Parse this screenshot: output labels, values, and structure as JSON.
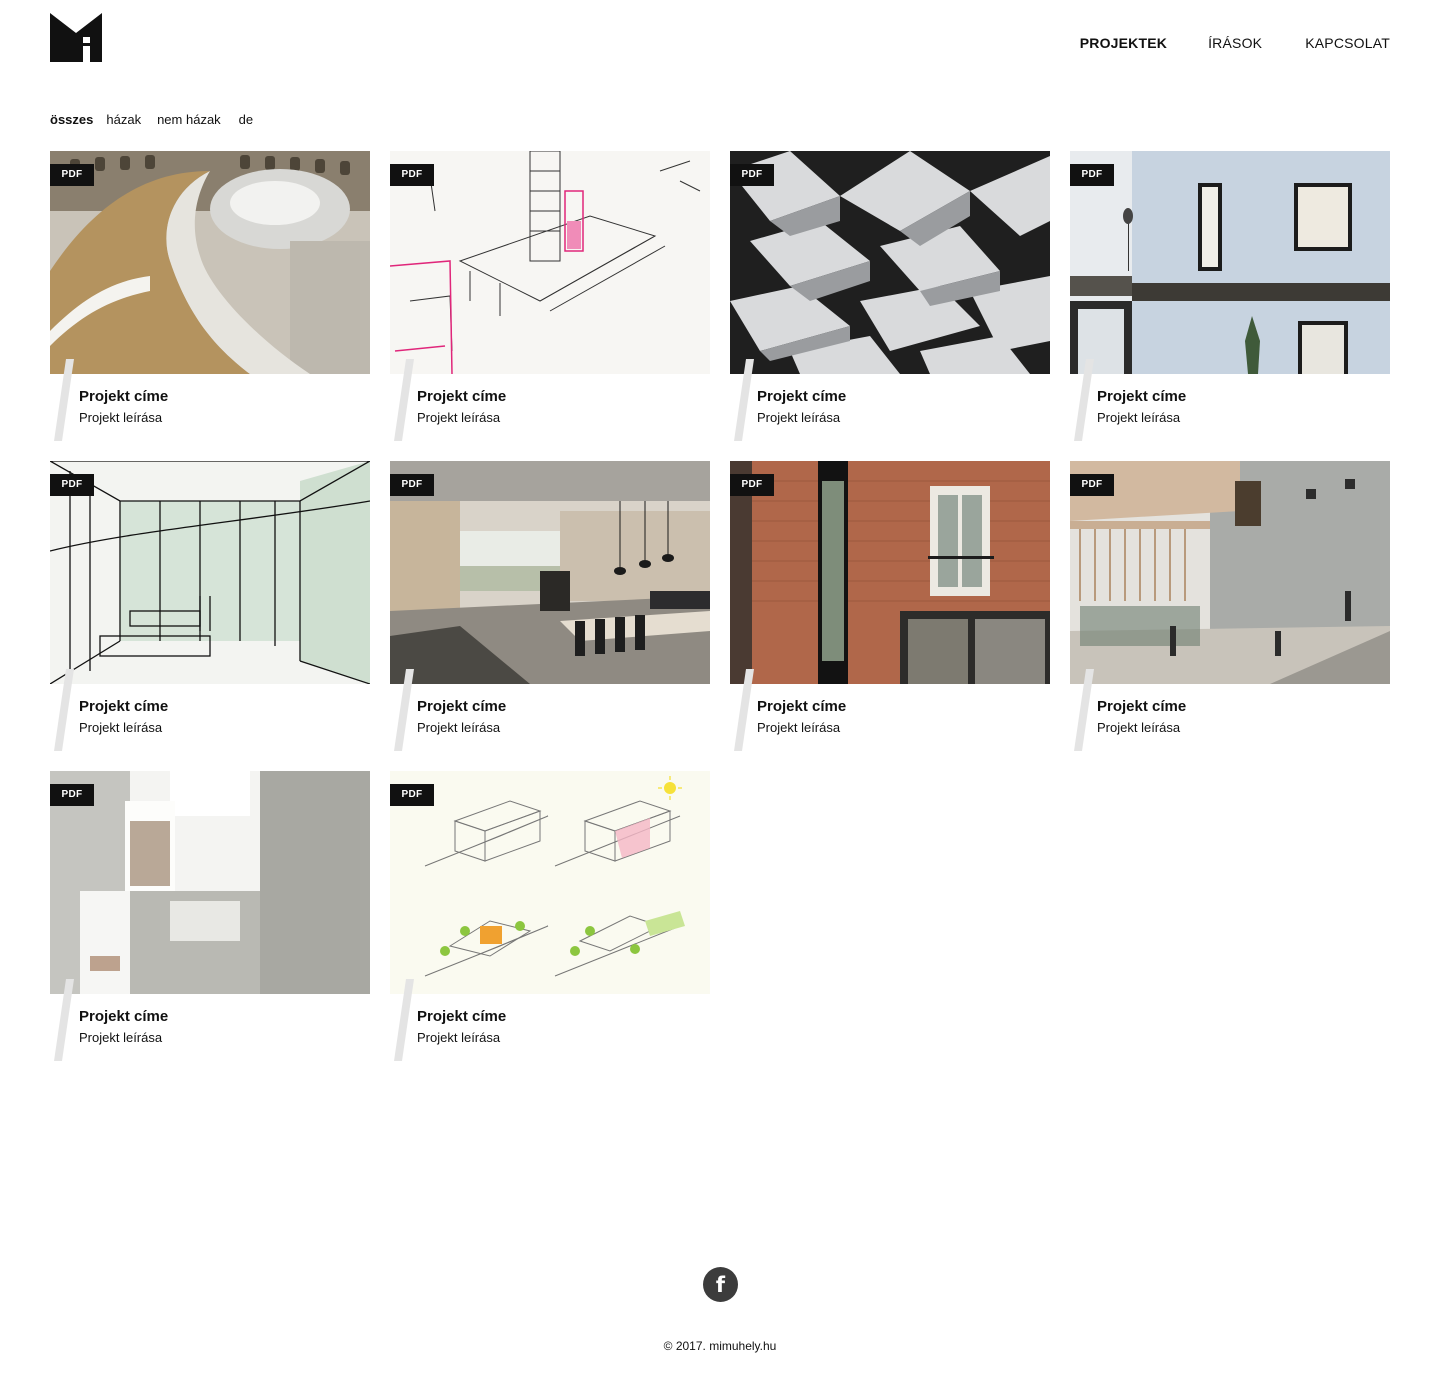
{
  "brand": {
    "logo_icon": "mimuhely-logo"
  },
  "nav": [
    {
      "label": "PROJEKTEK",
      "active": true
    },
    {
      "label": "ÍRÁSOK",
      "active": false
    },
    {
      "label": "KAPCSOLAT",
      "active": false
    }
  ],
  "filters": [
    {
      "label": "összes",
      "active": true
    },
    {
      "label": "házak",
      "active": false
    },
    {
      "label": "nem házak",
      "active": false
    },
    {
      "label": "de",
      "active": false
    }
  ],
  "projects": [
    {
      "badge": "PDF",
      "title": "Projekt címe",
      "description": "Projekt leírása",
      "image_icon": "spiral-staircase-photo"
    },
    {
      "badge": "PDF",
      "title": "Projekt címe",
      "description": "Projekt leírása",
      "image_icon": "sketch-drawing"
    },
    {
      "badge": "PDF",
      "title": "Projekt címe",
      "description": "Projekt leírása",
      "image_icon": "folded-ceiling-photo"
    },
    {
      "badge": "PDF",
      "title": "Projekt címe",
      "description": "Projekt leírása",
      "image_icon": "facade-photo"
    },
    {
      "badge": "PDF",
      "title": "Projekt címe",
      "description": "Projekt leírása",
      "image_icon": "interior-sketch"
    },
    {
      "badge": "PDF",
      "title": "Projekt címe",
      "description": "Projekt leírása",
      "image_icon": "dining-interior-photo"
    },
    {
      "badge": "PDF",
      "title": "Projekt címe",
      "description": "Projekt leírása",
      "image_icon": "brick-house-photo"
    },
    {
      "badge": "PDF",
      "title": "Projekt címe",
      "description": "Projekt leírása",
      "image_icon": "courtyard-render"
    },
    {
      "badge": "PDF",
      "title": "Projekt címe",
      "description": "Projekt leírása",
      "image_icon": "light-well-render"
    },
    {
      "badge": "PDF",
      "title": "Projekt címe",
      "description": "Projekt leírása",
      "image_icon": "axonometric-diagrams"
    }
  ],
  "footer": {
    "social_icon": "facebook-icon",
    "social_glyph": "f",
    "copyright": "© 2017. mimuhely.hu"
  }
}
